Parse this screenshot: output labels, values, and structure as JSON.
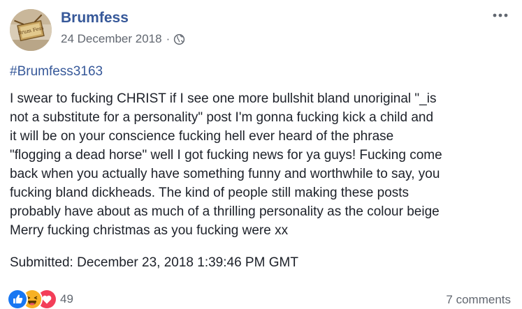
{
  "post": {
    "author": "Brumfess",
    "date": "24 December 2018",
    "separator": "·",
    "audience_icon": "globe-icon",
    "more_icon": "more-options-icon",
    "avatar_text": "Brum Fess",
    "hashtag": "#Brumfess3163",
    "body_lines": [
      "I swear to fucking CHRIST if I see one more bullshit bland unoriginal \"_is",
      "not a substitute for a personality\" post I'm gonna fucking kick a child and",
      "it will be on your conscience fucking hell ever heard of the phrase",
      "\"flogging a dead horse\" well I got fucking news for ya guys! Fucking come",
      "back when you actually have something funny and worthwhile to say, you",
      "fucking bland dickheads. The kind of people still making these posts",
      "probably have about as much of a thrilling personality as the colour beige",
      "Merry fucking christmas as you fucking were xx"
    ],
    "submitted": "Submitted: December 23, 2018 1:39:46 PM GMT"
  },
  "footer": {
    "reaction_icons": [
      "like-reaction-icon",
      "haha-reaction-icon",
      "love-reaction-icon"
    ],
    "reaction_count": "49",
    "comments": "7 comments"
  },
  "colors": {
    "link_blue": "#365899",
    "meta_gray": "#616770",
    "text": "#1d2129",
    "like_blue": "#1877f2",
    "haha_yellow": "#f7b125",
    "love_red": "#f33e58"
  }
}
